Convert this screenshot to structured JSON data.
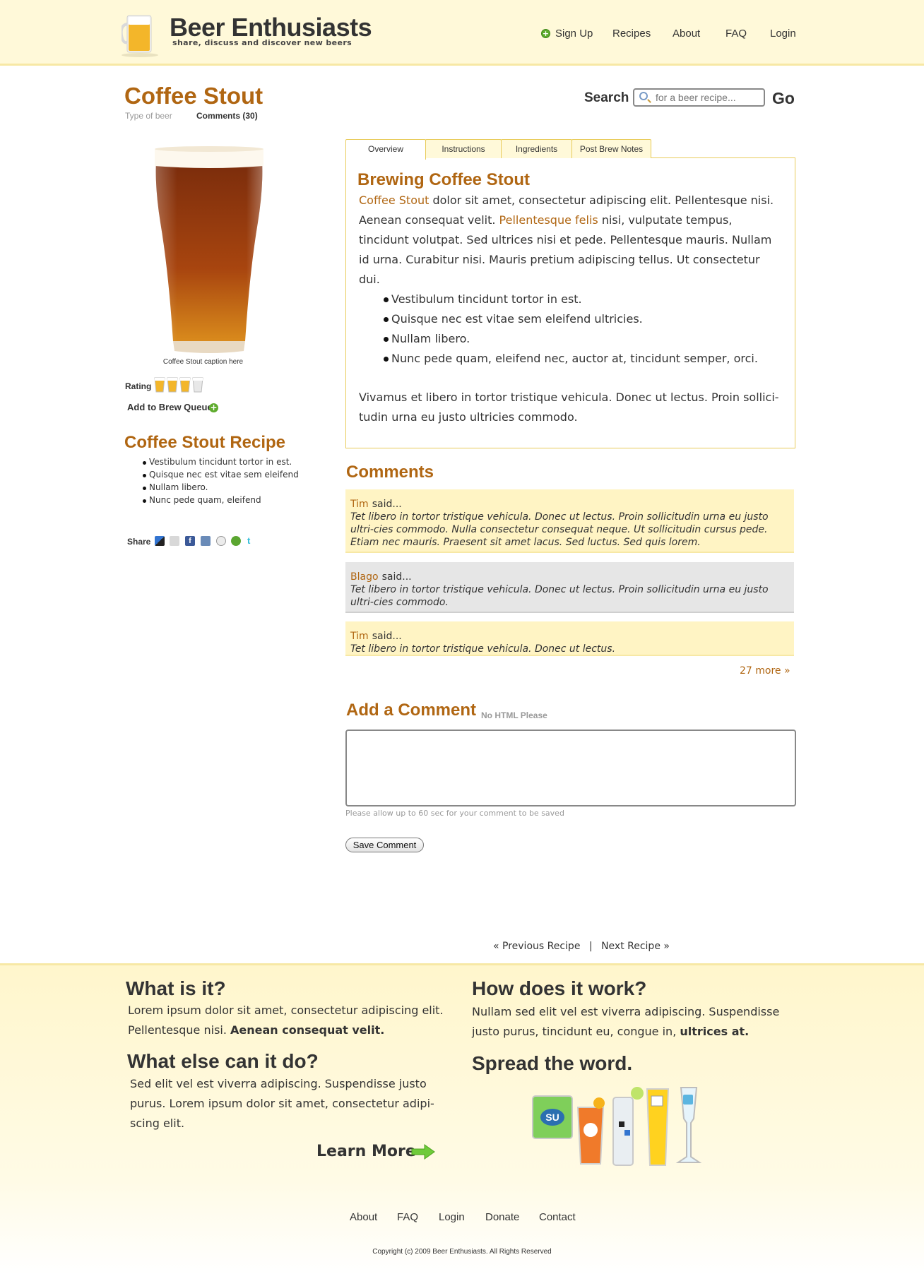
{
  "header": {
    "site_title": "Beer Enthusiasts",
    "tagline": "share, discuss and discover new beers",
    "nav": {
      "signup": "Sign Up",
      "recipes": "Recipes",
      "about": "About",
      "faq": "FAQ",
      "login": "Login"
    }
  },
  "page": {
    "title": "Coffee Stout",
    "subtabs": {
      "type": "Type of beer",
      "comments": "Comments (30)"
    }
  },
  "search": {
    "label": "Search",
    "placeholder": "for a beer recipe...",
    "go": "Go"
  },
  "sidebar": {
    "image_caption": "Coffee Stout caption here",
    "rating_label": "Rating",
    "rating": {
      "value": 3,
      "max": 4
    },
    "add_to_queue": "Add to Brew Queue",
    "recipe_heading": "Coffee Stout Recipe",
    "recipe_items": [
      "Vestibulum tincidunt tortor in est.",
      "Quisque nec est vitae sem eleifend",
      "Nullam libero.",
      "Nunc pede quam, eleifend"
    ],
    "share_label": "Share",
    "share_icons": [
      "delicious-icon",
      "digg-icon",
      "facebook-icon",
      "friendfeed-icon",
      "reddit-icon",
      "stumbleupon-icon",
      "twitter-icon"
    ]
  },
  "tabs": [
    "Overview",
    "Instructions",
    "Ingredients",
    "Post Brew Notes"
  ],
  "overview": {
    "title": "Brewing Coffee Stout",
    "link1": "Coffee Stout",
    "text1": " dolor sit amet, consectetur adipiscing elit. Pellentesque nisi. Aenean consequat velit. ",
    "link2": "Pellentesque felis",
    "text2": " nisi, vulputate tempus, tincidunt volutpat. Sed ultrices nisi et pede. Pellentesque mauris. Nullam id urna. Curabitur nisi. Mauris pretium adipiscing tellus. Ut consectetur dui.",
    "bullets": [
      "Vestibulum tincidunt tortor in est.",
      "Quisque nec est vitae sem eleifend ultricies.",
      "Nullam libero.",
      "Nunc pede quam, eleifend nec, auctor at, tincidunt semper, orci."
    ],
    "closing": "Vivamus et libero in tortor tristique vehicula. Donec ut lectus. Proin sollici-tudin urna eu justo ultricies commodo."
  },
  "comments": {
    "heading": "Comments",
    "said": "said...",
    "items": [
      {
        "author": "Tim",
        "body": "Tet libero in tortor tristique vehicula. Donec ut lectus. Proin sollicitudin urna eu justo ultri-cies commodo. Nulla consectetur consequat neque. Ut sollicitudin cursus pede. Etiam nec mauris. Praesent sit amet lacus. Sed luctus. Sed quis lorem."
      },
      {
        "author": "Blago",
        "body": "Tet libero in tortor tristique vehicula. Donec ut lectus. Proin sollicitudin urna eu justo ultri-cies commodo."
      },
      {
        "author": "Tim",
        "body": "Tet libero in tortor tristique vehicula. Donec ut lectus."
      }
    ],
    "more": "27 more »"
  },
  "add_comment": {
    "heading": "Add a Comment",
    "note": "No HTML Please",
    "save_note": "Please allow up to 60 sec for your comment to be saved",
    "save_button": "Save Comment"
  },
  "pager": {
    "prev": "« Previous Recipe",
    "sep": "|",
    "next": "Next Recipe »"
  },
  "footer": {
    "what_heading": "What is it?",
    "what_text": "Lorem ipsum dolor sit amet, consectetur adipiscing elit. Pellentesque nisi. ",
    "what_bold": "Aenean consequat velit.",
    "else_heading": "What else can it do?",
    "else_text": "Sed elit vel est viverra adipiscing. Suspendisse justo purus. Lorem ipsum dolor sit amet, consectetur adipi-scing elit.",
    "learn_more": "Learn More",
    "how_heading": "How does it work?",
    "how_text": "Nullam sed elit vel est viverra adipiscing. Suspendisse justo purus, tincidunt eu, congue in, ",
    "how_bold": "ultrices at.",
    "spread_heading": "Spread the word.",
    "nav": {
      "about": "About",
      "faq": "FAQ",
      "login": "Login",
      "donate": "Donate",
      "contact": "Contact"
    },
    "copyright": "Copyright (c) 2009 Beer Enthusiasts. All Rights Reserved"
  },
  "colors": {
    "accent": "#b06612",
    "header_bg": "#fff9d9",
    "border_gold": "#e8cb5a",
    "comment_yellow": "#fff4c4",
    "comment_gray": "#e6e6e6"
  }
}
